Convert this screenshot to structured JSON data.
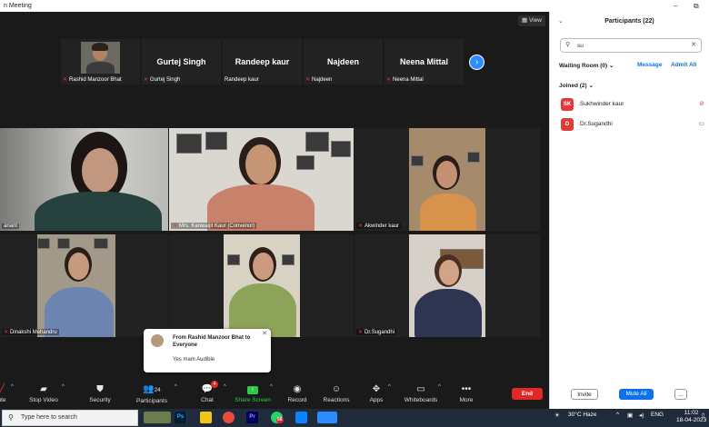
{
  "window": {
    "title": "n Meeting"
  },
  "meeting": {
    "view_label": "View",
    "strip": [
      {
        "name_big": "",
        "label": "Rashid Manzoor Bhat"
      },
      {
        "name_big": "Gurtej Singh",
        "label": "Gurtej Singh"
      },
      {
        "name_big": "Randeep kaur",
        "label": "Randeep kaur"
      },
      {
        "name_big": "Najdeen",
        "label": "Najdeen"
      },
      {
        "name_big": "Neena Mittal",
        "label": "Neena Mittal"
      }
    ],
    "gallery": [
      {
        "label": "anant"
      },
      {
        "label": "Mrs. Kanwaljit Kaur (Convenor)"
      },
      {
        "label": "Akwinder kaur"
      },
      {
        "label": "Dinakshi Mehandru"
      },
      {
        "label": ""
      },
      {
        "label": "Dr.Sugandhi"
      }
    ],
    "chat_popup": {
      "from": "From Rashid Manzoor Bhat to Everyone",
      "message": "Yes mam Audible"
    }
  },
  "toolbar": {
    "items": [
      {
        "label": "ute",
        "icon": "mic-icon"
      },
      {
        "label": "Stop Video",
        "icon": "video-icon"
      },
      {
        "label": "Security",
        "icon": "shield-icon"
      },
      {
        "label": "Participants",
        "icon": "people-icon",
        "count": "24"
      },
      {
        "label": "Chat",
        "icon": "chat-icon",
        "badge": "4"
      },
      {
        "label": "Share Screen",
        "icon": "share-icon"
      },
      {
        "label": "Record",
        "icon": "record-icon"
      },
      {
        "label": "Reactions",
        "icon": "emoji-icon"
      },
      {
        "label": "Apps",
        "icon": "apps-icon"
      },
      {
        "label": "Whiteboards",
        "icon": "whiteboard-icon"
      },
      {
        "label": "More",
        "icon": "more-icon"
      }
    ],
    "end_label": "End",
    "share_color": "#2fc94a"
  },
  "participants_panel": {
    "title": "Participants (22)",
    "search_value": "su",
    "waiting_room": "Waiting Room (0)",
    "message_link": "Message",
    "admit_all_link": "Admit All",
    "joined": "Joined (2)",
    "participants": [
      {
        "initials": "SK",
        "name": "Sukhwinder kaur",
        "camera": "camera-off-icon"
      },
      {
        "initials": "D",
        "name": "Dr.Sugandhi",
        "camera": "camera-icon"
      }
    ],
    "invite_label": "Invite",
    "mute_all_label": "Mute All",
    "more_label": "..."
  },
  "taskbar": {
    "search_placeholder": "Type here to search",
    "apps": [
      "Ps",
      "Pr"
    ],
    "whatsapp_badge": "56",
    "weather": "30°C  Haze",
    "time": "11:02",
    "date": "18-04-2023"
  },
  "colors": {
    "zoom_blue": "#0e71eb",
    "end_red": "#e02828",
    "avatar_red": "#e03b3b"
  }
}
